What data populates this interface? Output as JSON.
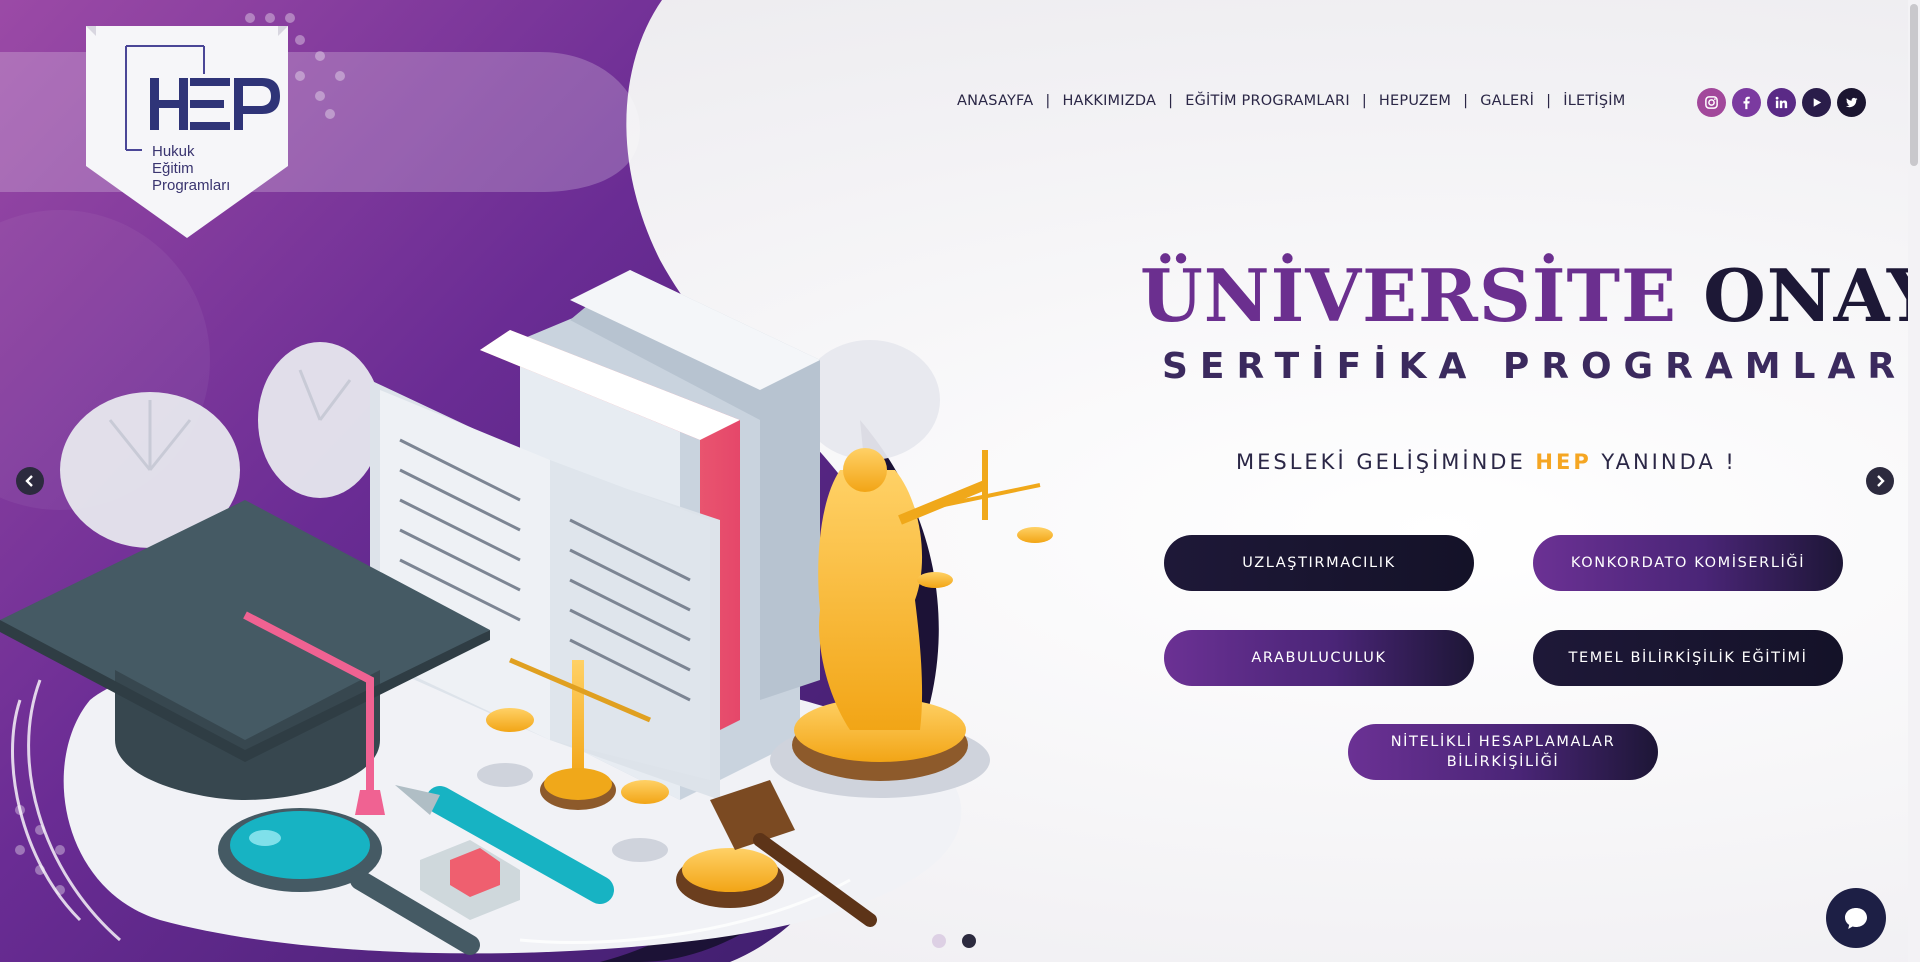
{
  "logo": {
    "mark": "HEP",
    "line1": "Hukuk",
    "line2": "Eğitim",
    "line3": "Programları"
  },
  "nav": {
    "items": [
      "ANASAYFA",
      "HAKKIMIZDA",
      "EĞİTİM PROGRAMLARI",
      "HEPUZEM",
      "GALERİ",
      "İLETİŞİM"
    ],
    "separator": "|"
  },
  "social": {
    "icons": [
      "instagram-icon",
      "facebook-icon",
      "linkedin-icon",
      "youtube-icon",
      "twitter-icon"
    ]
  },
  "hero": {
    "title_part1": "ÜNİVERSİTE",
    "title_part2": " ONAYLI",
    "subtitle": "SERTİFİKA PROGRAMLARI",
    "tagline_pre": "MESLEKİ GELİŞİMİNDE ",
    "tagline_highlight": "HEP",
    "tagline_post": " YANINDA !"
  },
  "buttons": {
    "uzlastirmacilik": "UZLAŞTIRMACILIK",
    "konkordato": "KONKORDATO KOMİSERLİĞİ",
    "arabuluculuk": "ARABULUCULUK",
    "bilirkisilik": "TEMEL BİLİRKİŞİLİK EĞİTİMİ",
    "nitelikli_line1": "NİTELİKLİ HESAPLAMALAR",
    "nitelikli_line2": "BİLİRKİŞİLİĞİ"
  },
  "slider": {
    "slide_count": 2,
    "active_slide": 2
  },
  "colors": {
    "brand_purple": "#6b2f8f",
    "brand_dark": "#1d1836",
    "accent_gold": "#f5a623",
    "social_purple": "#6e3394"
  }
}
